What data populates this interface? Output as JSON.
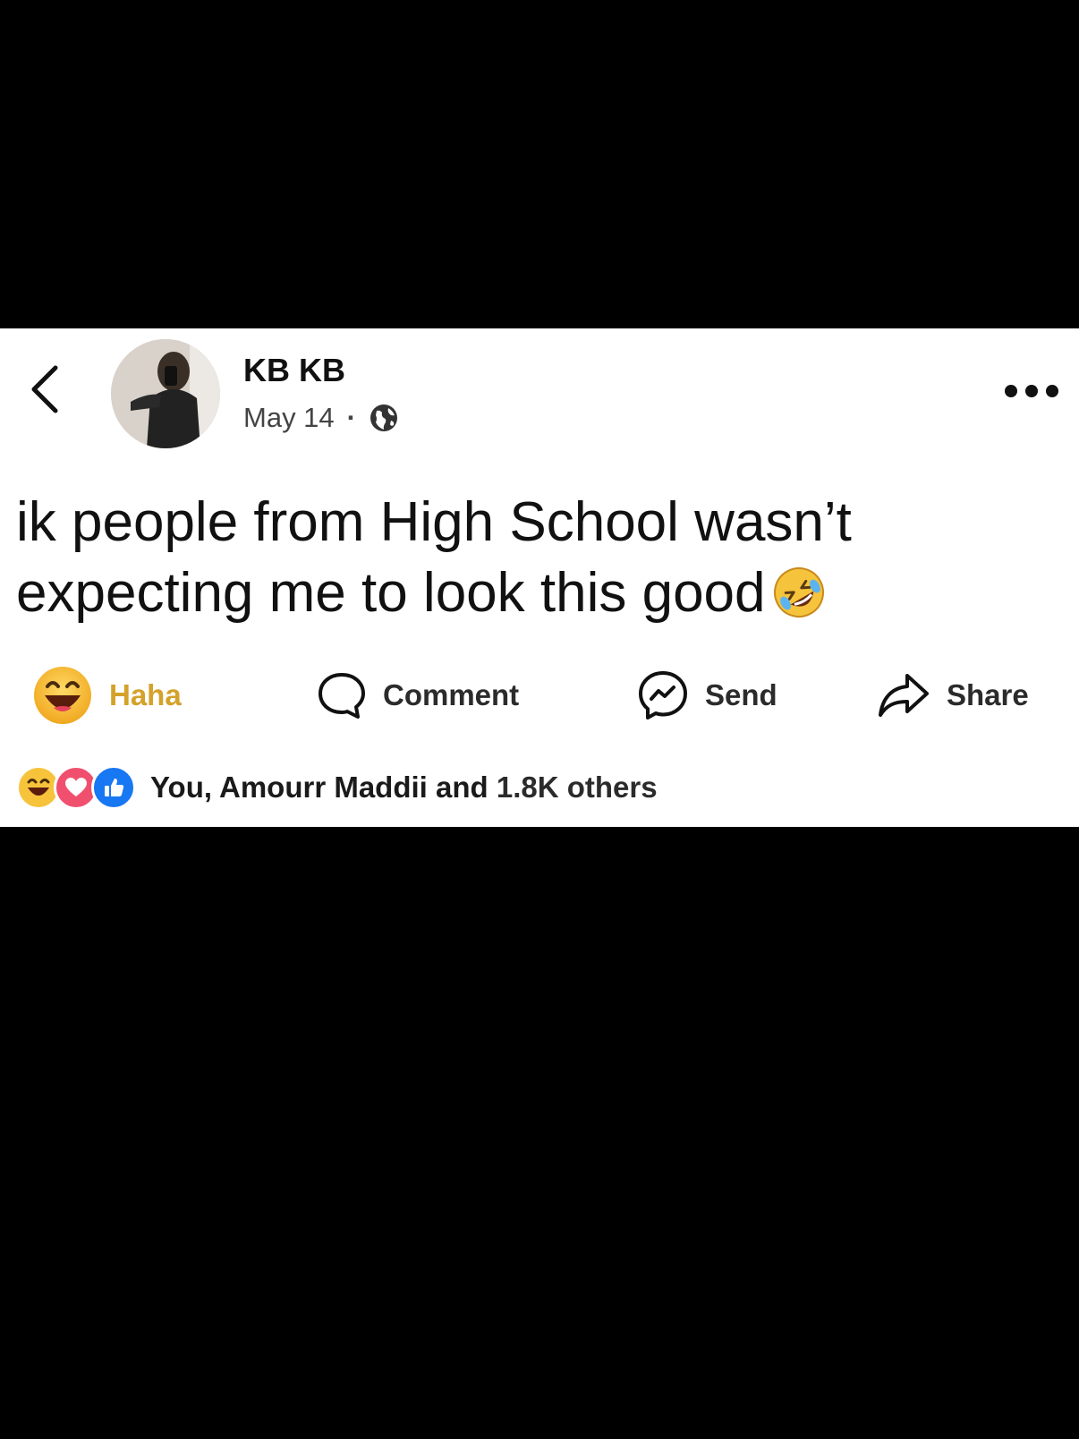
{
  "post": {
    "author": "KB KB",
    "date": "May 14",
    "separator": "·",
    "privacy_icon": "globe-icon",
    "text_line1": "ik people from High School wasn’t",
    "text_line2": "expecting me to look this good",
    "emoji": "rolling-on-floor-laughing-emoji"
  },
  "nav": {
    "back_icon": "chevron-left-icon",
    "more_icon": "more-dots-icon"
  },
  "actions": {
    "haha_label": "Haha",
    "comment_label": "Comment",
    "send_label": "Send",
    "share_label": "Share"
  },
  "reactions": {
    "icons": [
      "haha-icon",
      "love-icon",
      "like-icon"
    ],
    "names": "You, Amourr Maddii and",
    "count_text": "1.8K others"
  },
  "colors": {
    "haha_accent": "#d4a22a",
    "love": "#f0506e",
    "like": "#1877f2",
    "card_bg": "#ffffff",
    "page_bg": "#000000"
  }
}
